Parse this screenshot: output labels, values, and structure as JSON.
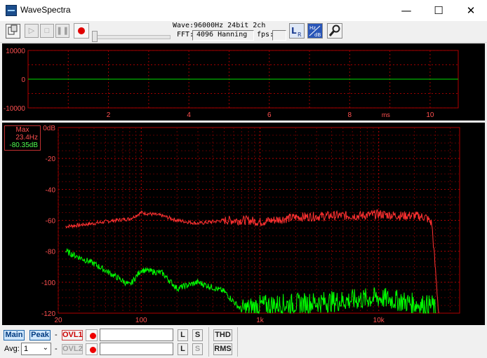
{
  "window": {
    "title": "WaveSpectra",
    "minimize": "—",
    "maximize": "☐",
    "close": "✕"
  },
  "toolbar": {
    "wave_label": "Wave:",
    "wave_value": "96000Hz 24bit 2ch",
    "fft_label": "FFT:",
    "fft_value": "4096 Hanning",
    "fps_label": "fps:",
    "fps_value": ""
  },
  "wave_panel": {
    "y_ticks": [
      "10000",
      "0",
      "-10000"
    ],
    "x_ticks": [
      "2",
      "4",
      "6",
      "8",
      "10"
    ],
    "x_unit": "ms",
    "y_max": 10000,
    "x_max_ms": 10.7
  },
  "spectrum_panel": {
    "readout": {
      "title": "Max",
      "freq": "23.4Hz",
      "level": "-80.35dB"
    },
    "y_ticks": [
      "0dB",
      "-20",
      "-40",
      "-60",
      "-80",
      "-100",
      "-120"
    ],
    "x_ticks": [
      "20",
      "100",
      "1k",
      "10k"
    ],
    "x_range_hz": [
      20,
      48000
    ],
    "y_range_db": [
      -120,
      0
    ],
    "colors": {
      "peak_trace": "#ff3030",
      "main_trace": "#00ff00",
      "grid": "#b00000",
      "axis_text": "#ff6060"
    }
  },
  "chart_data": {
    "type": "line",
    "x_scale": "log",
    "xlim": [
      20,
      48000
    ],
    "ylim": [
      -120,
      0
    ],
    "series": [
      {
        "color": "#ff3030",
        "x": [
          23,
          40,
          60,
          80,
          100,
          150,
          200,
          300,
          500,
          800,
          1000,
          2000,
          4000,
          7000,
          10000,
          15000,
          20000,
          25000,
          28000,
          32000
        ],
        "y": [
          -64,
          -62,
          -60,
          -59,
          -55,
          -57,
          -60,
          -62,
          -60,
          -60,
          -61,
          -58,
          -57,
          -57,
          -56,
          -57,
          -57,
          -58,
          -62,
          -120
        ]
      },
      {
        "color": "#00ff00",
        "x": [
          23,
          40,
          60,
          80,
          100,
          150,
          200,
          300,
          500,
          700,
          1000,
          2000,
          5000,
          10000,
          15000,
          20000,
          25000,
          29000,
          30000
        ],
        "y": [
          -80,
          -88,
          -96,
          -102,
          -92,
          -94,
          -104,
          -100,
          -106,
          -118,
          -115,
          -114,
          -112,
          -110,
          -112,
          -114,
          -115,
          -115,
          -120
        ]
      }
    ]
  },
  "bottom": {
    "main": "Main",
    "peak": "Peak",
    "dash1": "-",
    "ovl1": "OVL1",
    "avg_label": "Avg:",
    "avg_value": "1",
    "dash2": "-",
    "ovl2": "OVL2",
    "l1": "L",
    "s1": "S",
    "l2": "L",
    "s2": "S",
    "thd": "THD",
    "rms": "RMS",
    "field1": "",
    "field2": ""
  }
}
